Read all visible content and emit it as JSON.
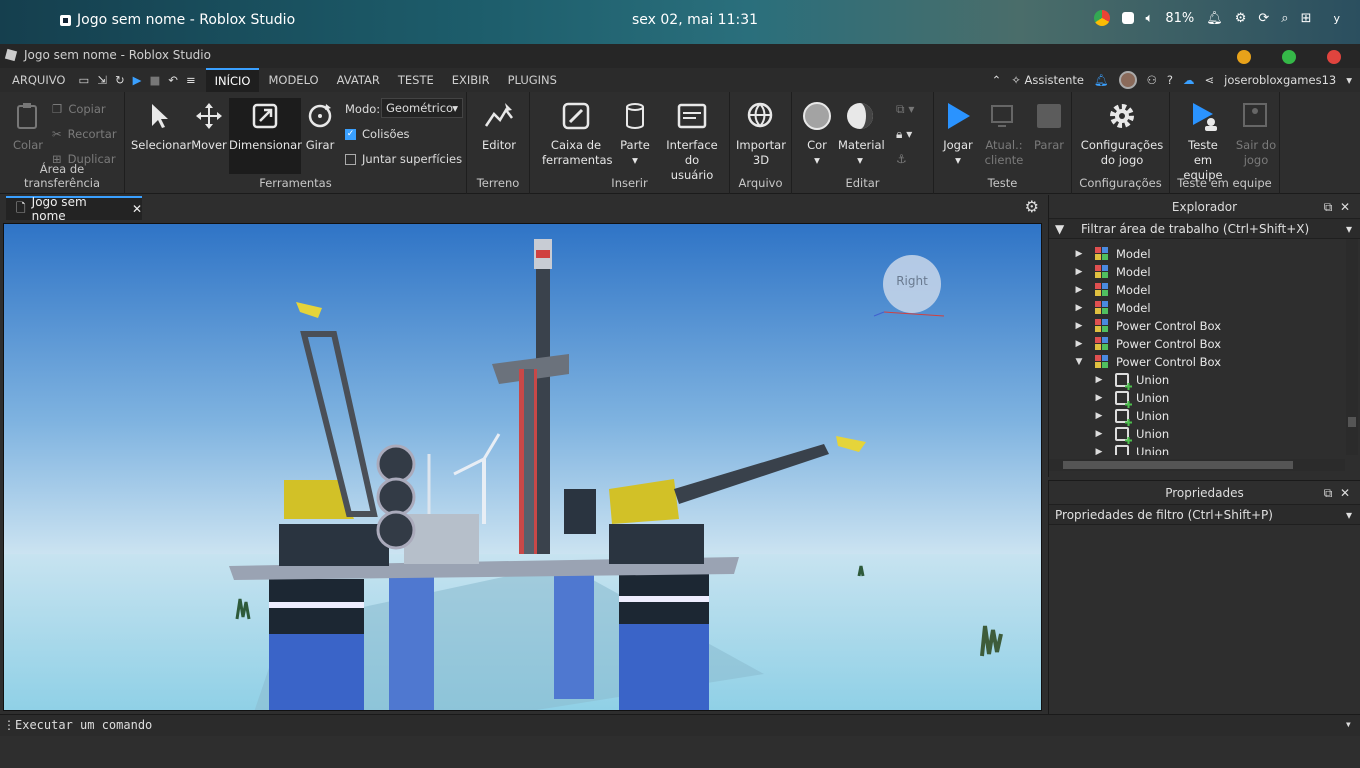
{
  "os": {
    "app_title": "Jogo sem nome - Roblox Studio",
    "clock": "sex 02, mai  11:31",
    "battery": "81%"
  },
  "window": {
    "title": "Jogo sem nome - Roblox Studio"
  },
  "menu": {
    "file": "ARQUIVO",
    "tabs": [
      "INÍCIO",
      "MODELO",
      "AVATAR",
      "TESTE",
      "EXIBIR",
      "PLUGINS"
    ],
    "assistant": "Assistente",
    "username": "joserobloxgames13"
  },
  "ribbon": {
    "clipboard": {
      "paste": "Colar",
      "copy": "Copiar",
      "cut": "Recortar",
      "duplicate": "Duplicar",
      "label": "Área de transferência"
    },
    "tools": {
      "select": "Selecionar",
      "move": "Mover",
      "scale": "Dimensionar",
      "rotate": "Girar",
      "mode_label": "Modo:",
      "mode_value": "Geométrico",
      "collisions": "Colisões",
      "join": "Juntar superfícies",
      "label": "Ferramentas"
    },
    "terrain": {
      "editor": "Editor",
      "label": "Terreno"
    },
    "insert": {
      "toolbox_1": "Caixa de",
      "toolbox_2": "ferramentas",
      "part": "Parte",
      "ui_1": "Interface do",
      "ui_2": "usuário",
      "label": "Inserir"
    },
    "file": {
      "import_1": "Importar",
      "import_2": "3D",
      "label": "Arquivo"
    },
    "edit": {
      "color": "Cor",
      "material": "Material",
      "label": "Editar"
    },
    "test": {
      "play": "Jogar",
      "update_1": "Atual.:",
      "update_2": "cliente",
      "stop": "Parar",
      "label": "Teste"
    },
    "settings": {
      "game_1": "Configurações",
      "game_2": "do jogo",
      "label": "Configurações"
    },
    "team": {
      "test_1": "Teste em",
      "test_2": "equipe",
      "exit_1": "Sair do",
      "exit_2": "jogo",
      "label": "Teste em equipe"
    }
  },
  "document_tab": {
    "label": "Jogo sem nome"
  },
  "viewport": {
    "view_cube_label": "Right"
  },
  "explorer": {
    "title": "Explorador",
    "filter": "Filtrar área de trabalho (Ctrl+Shift+X)",
    "items": [
      {
        "label": "Model",
        "kind": "model",
        "depth": 0,
        "state": "collapsed"
      },
      {
        "label": "Model",
        "kind": "model",
        "depth": 0,
        "state": "collapsed"
      },
      {
        "label": "Model",
        "kind": "model",
        "depth": 0,
        "state": "collapsed"
      },
      {
        "label": "Model",
        "kind": "model",
        "depth": 0,
        "state": "collapsed"
      },
      {
        "label": "Power Control Box",
        "kind": "model",
        "depth": 0,
        "state": "collapsed"
      },
      {
        "label": "Power Control Box",
        "kind": "model",
        "depth": 0,
        "state": "collapsed"
      },
      {
        "label": "Power Control Box",
        "kind": "model",
        "depth": 0,
        "state": "expanded"
      },
      {
        "label": "Union",
        "kind": "union",
        "depth": 1,
        "state": "collapsed"
      },
      {
        "label": "Union",
        "kind": "union",
        "depth": 1,
        "state": "collapsed"
      },
      {
        "label": "Union",
        "kind": "union",
        "depth": 1,
        "state": "collapsed"
      },
      {
        "label": "Union",
        "kind": "union",
        "depth": 1,
        "state": "collapsed"
      },
      {
        "label": "Union",
        "kind": "union",
        "depth": 1,
        "state": "collapsed"
      }
    ]
  },
  "properties": {
    "title": "Propriedades",
    "filter": "Propriedades de filtro (Ctrl+Shift+P)"
  },
  "command_bar": {
    "placeholder": "Executar um comando"
  },
  "colors": {
    "accent": "#3aa0ff",
    "play": "#2a93ff",
    "dot_yellow": "#e8a21a",
    "dot_green": "#35b848",
    "dot_red": "#e0443e"
  }
}
